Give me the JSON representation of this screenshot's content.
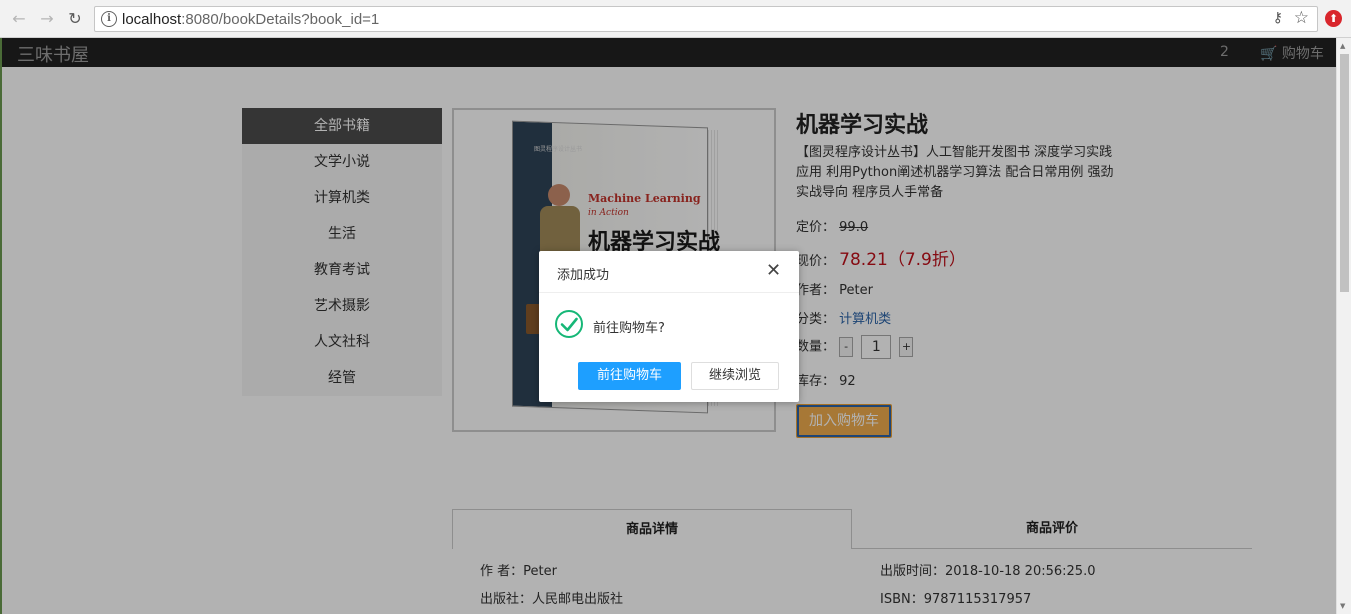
{
  "browser": {
    "url_host": "localhost",
    "url_rest": ":8080/bookDetails?book_id=1"
  },
  "site": {
    "brand": "三味书屋",
    "cart_count": "2",
    "cart_label": "购物车"
  },
  "sidebar": {
    "items": [
      {
        "label": "全部书籍",
        "active": true
      },
      {
        "label": "文学小说"
      },
      {
        "label": "计算机类"
      },
      {
        "label": "生活"
      },
      {
        "label": "教育考试"
      },
      {
        "label": "艺术摄影"
      },
      {
        "label": "人文社科"
      },
      {
        "label": "经管"
      }
    ]
  },
  "cover": {
    "en_title": "Machine Learning",
    "en_sub": "in Action",
    "cn_title": "机器学习实战",
    "series": "图灵程序设计丛书"
  },
  "book": {
    "title": "机器学习实战",
    "description": "【图灵程序设计丛书】人工智能开发图书 深度学习实践应用 利用Python阐述机器学习算法 配合日常用例 强劲实战导向 程序员人手常备",
    "orig_price_label": "定价：",
    "orig_price": "99.0",
    "now_price_label": "现价：",
    "now_price": "78.21（7.9折）",
    "author_label": "作者：",
    "author": "Peter",
    "category_label": "分类：",
    "category": "计算机类",
    "qty_label": "数量：",
    "qty_minus": "-",
    "qty_value": "1",
    "qty_plus": "+",
    "stock_label": "库存：",
    "stock": "92",
    "add_cart": "加入购物车"
  },
  "tabs": {
    "details": "商品详情",
    "reviews": "商品评价"
  },
  "details": {
    "author": "作 者：Peter",
    "publisher": "出版社：人民邮电出版社",
    "pub_time": "出版时间：2018-10-18 20:56:25.0",
    "isbn": "ISBN：9787115317957"
  },
  "dialog": {
    "title": "添加成功",
    "close": "✕",
    "message": "前往购物车?",
    "go_cart": "前往购物车",
    "continue": "继续浏览"
  },
  "colors": {
    "navbar": "#222222",
    "price": "#c0101a",
    "primary_btn": "#1e9fff",
    "success_check": "#16b777"
  }
}
